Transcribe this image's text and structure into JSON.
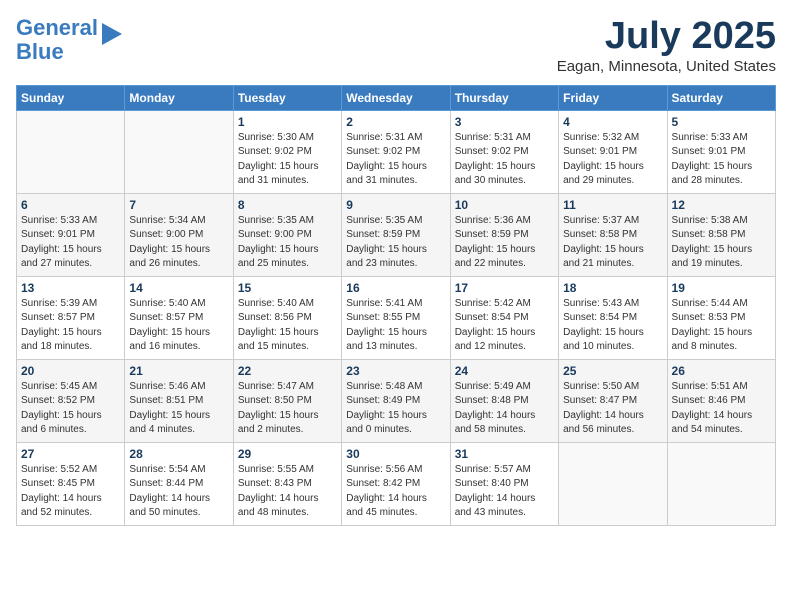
{
  "header": {
    "logo_line1": "General",
    "logo_line2": "Blue",
    "month_title": "July 2025",
    "location": "Eagan, Minnesota, United States"
  },
  "weekdays": [
    "Sunday",
    "Monday",
    "Tuesday",
    "Wednesday",
    "Thursday",
    "Friday",
    "Saturday"
  ],
  "weeks": [
    [
      {
        "day": "",
        "detail": ""
      },
      {
        "day": "",
        "detail": ""
      },
      {
        "day": "1",
        "detail": "Sunrise: 5:30 AM\nSunset: 9:02 PM\nDaylight: 15 hours\nand 31 minutes."
      },
      {
        "day": "2",
        "detail": "Sunrise: 5:31 AM\nSunset: 9:02 PM\nDaylight: 15 hours\nand 31 minutes."
      },
      {
        "day": "3",
        "detail": "Sunrise: 5:31 AM\nSunset: 9:02 PM\nDaylight: 15 hours\nand 30 minutes."
      },
      {
        "day": "4",
        "detail": "Sunrise: 5:32 AM\nSunset: 9:01 PM\nDaylight: 15 hours\nand 29 minutes."
      },
      {
        "day": "5",
        "detail": "Sunrise: 5:33 AM\nSunset: 9:01 PM\nDaylight: 15 hours\nand 28 minutes."
      }
    ],
    [
      {
        "day": "6",
        "detail": "Sunrise: 5:33 AM\nSunset: 9:01 PM\nDaylight: 15 hours\nand 27 minutes."
      },
      {
        "day": "7",
        "detail": "Sunrise: 5:34 AM\nSunset: 9:00 PM\nDaylight: 15 hours\nand 26 minutes."
      },
      {
        "day": "8",
        "detail": "Sunrise: 5:35 AM\nSunset: 9:00 PM\nDaylight: 15 hours\nand 25 minutes."
      },
      {
        "day": "9",
        "detail": "Sunrise: 5:35 AM\nSunset: 8:59 PM\nDaylight: 15 hours\nand 23 minutes."
      },
      {
        "day": "10",
        "detail": "Sunrise: 5:36 AM\nSunset: 8:59 PM\nDaylight: 15 hours\nand 22 minutes."
      },
      {
        "day": "11",
        "detail": "Sunrise: 5:37 AM\nSunset: 8:58 PM\nDaylight: 15 hours\nand 21 minutes."
      },
      {
        "day": "12",
        "detail": "Sunrise: 5:38 AM\nSunset: 8:58 PM\nDaylight: 15 hours\nand 19 minutes."
      }
    ],
    [
      {
        "day": "13",
        "detail": "Sunrise: 5:39 AM\nSunset: 8:57 PM\nDaylight: 15 hours\nand 18 minutes."
      },
      {
        "day": "14",
        "detail": "Sunrise: 5:40 AM\nSunset: 8:57 PM\nDaylight: 15 hours\nand 16 minutes."
      },
      {
        "day": "15",
        "detail": "Sunrise: 5:40 AM\nSunset: 8:56 PM\nDaylight: 15 hours\nand 15 minutes."
      },
      {
        "day": "16",
        "detail": "Sunrise: 5:41 AM\nSunset: 8:55 PM\nDaylight: 15 hours\nand 13 minutes."
      },
      {
        "day": "17",
        "detail": "Sunrise: 5:42 AM\nSunset: 8:54 PM\nDaylight: 15 hours\nand 12 minutes."
      },
      {
        "day": "18",
        "detail": "Sunrise: 5:43 AM\nSunset: 8:54 PM\nDaylight: 15 hours\nand 10 minutes."
      },
      {
        "day": "19",
        "detail": "Sunrise: 5:44 AM\nSunset: 8:53 PM\nDaylight: 15 hours\nand 8 minutes."
      }
    ],
    [
      {
        "day": "20",
        "detail": "Sunrise: 5:45 AM\nSunset: 8:52 PM\nDaylight: 15 hours\nand 6 minutes."
      },
      {
        "day": "21",
        "detail": "Sunrise: 5:46 AM\nSunset: 8:51 PM\nDaylight: 15 hours\nand 4 minutes."
      },
      {
        "day": "22",
        "detail": "Sunrise: 5:47 AM\nSunset: 8:50 PM\nDaylight: 15 hours\nand 2 minutes."
      },
      {
        "day": "23",
        "detail": "Sunrise: 5:48 AM\nSunset: 8:49 PM\nDaylight: 15 hours\nand 0 minutes."
      },
      {
        "day": "24",
        "detail": "Sunrise: 5:49 AM\nSunset: 8:48 PM\nDaylight: 14 hours\nand 58 minutes."
      },
      {
        "day": "25",
        "detail": "Sunrise: 5:50 AM\nSunset: 8:47 PM\nDaylight: 14 hours\nand 56 minutes."
      },
      {
        "day": "26",
        "detail": "Sunrise: 5:51 AM\nSunset: 8:46 PM\nDaylight: 14 hours\nand 54 minutes."
      }
    ],
    [
      {
        "day": "27",
        "detail": "Sunrise: 5:52 AM\nSunset: 8:45 PM\nDaylight: 14 hours\nand 52 minutes."
      },
      {
        "day": "28",
        "detail": "Sunrise: 5:54 AM\nSunset: 8:44 PM\nDaylight: 14 hours\nand 50 minutes."
      },
      {
        "day": "29",
        "detail": "Sunrise: 5:55 AM\nSunset: 8:43 PM\nDaylight: 14 hours\nand 48 minutes."
      },
      {
        "day": "30",
        "detail": "Sunrise: 5:56 AM\nSunset: 8:42 PM\nDaylight: 14 hours\nand 45 minutes."
      },
      {
        "day": "31",
        "detail": "Sunrise: 5:57 AM\nSunset: 8:40 PM\nDaylight: 14 hours\nand 43 minutes."
      },
      {
        "day": "",
        "detail": ""
      },
      {
        "day": "",
        "detail": ""
      }
    ]
  ]
}
